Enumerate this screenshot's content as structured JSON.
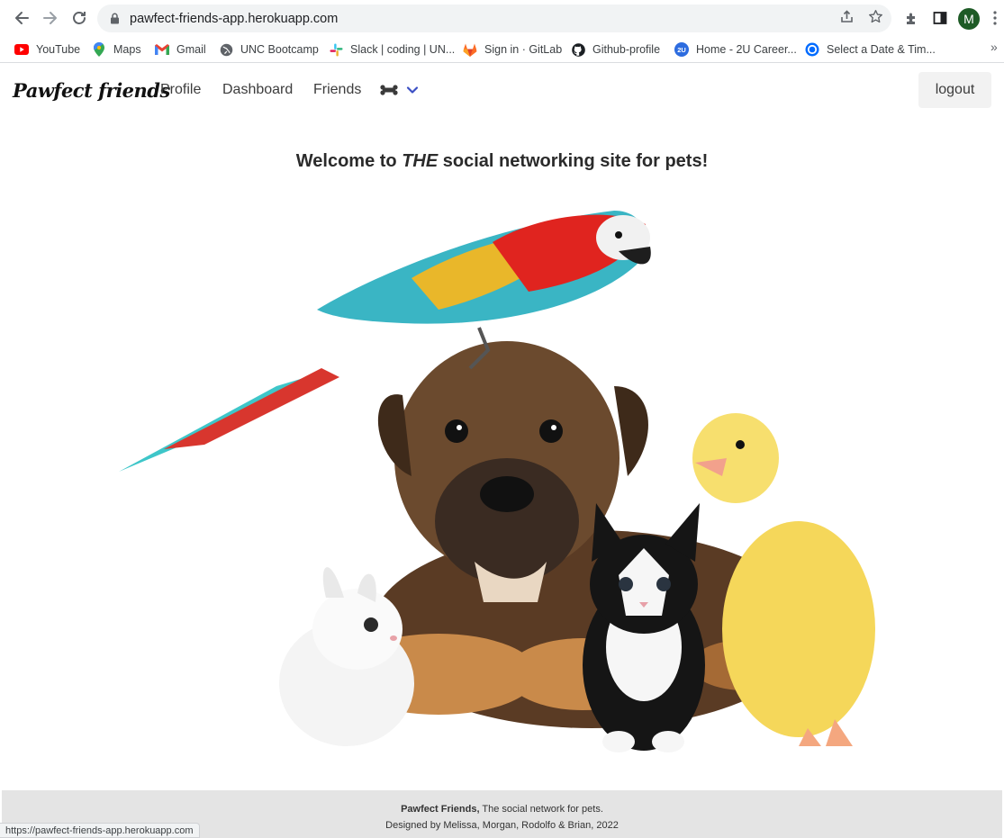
{
  "browser": {
    "url": "pawfect-friends-app.herokuapp.com",
    "avatar_letter": "M",
    "avatar_color": "#1e5b26",
    "status_url": "https://pawfect-friends-app.herokuapp.com",
    "bookmarks": [
      {
        "label": "YouTube",
        "icon": "youtube-icon"
      },
      {
        "label": "Maps",
        "icon": "maps-pin-icon"
      },
      {
        "label": "Gmail",
        "icon": "gmail-icon"
      },
      {
        "label": "UNC Bootcamp",
        "icon": "globe-icon"
      },
      {
        "label": "Slack | coding | UN...",
        "icon": "slack-icon"
      },
      {
        "label": "Sign in · GitLab",
        "icon": "gitlab-icon"
      },
      {
        "label": "Github-profile",
        "icon": "github-icon"
      },
      {
        "label": "Home - 2U Career...",
        "icon": "2u-icon"
      },
      {
        "label": "Select a Date & Tim...",
        "icon": "calendly-icon"
      }
    ],
    "bookmarks_more": "»"
  },
  "navbar": {
    "logo": "Pawfect friends",
    "links": [
      "Profile",
      "Dashboard",
      "Friends"
    ],
    "logout_label": "logout",
    "accent_color": "#3b4fc4"
  },
  "main": {
    "welcome_prefix": "Welcome to ",
    "welcome_emphasis": "THE",
    "welcome_suffix": " social networking site for pets!"
  },
  "footer": {
    "brand": "Pawfect Friends,",
    "tagline": " The social network for pets.",
    "credits": "Designed by Melissa, Morgan, Rodolfo & Brian, 2022",
    "background": "#e4e4e4"
  }
}
